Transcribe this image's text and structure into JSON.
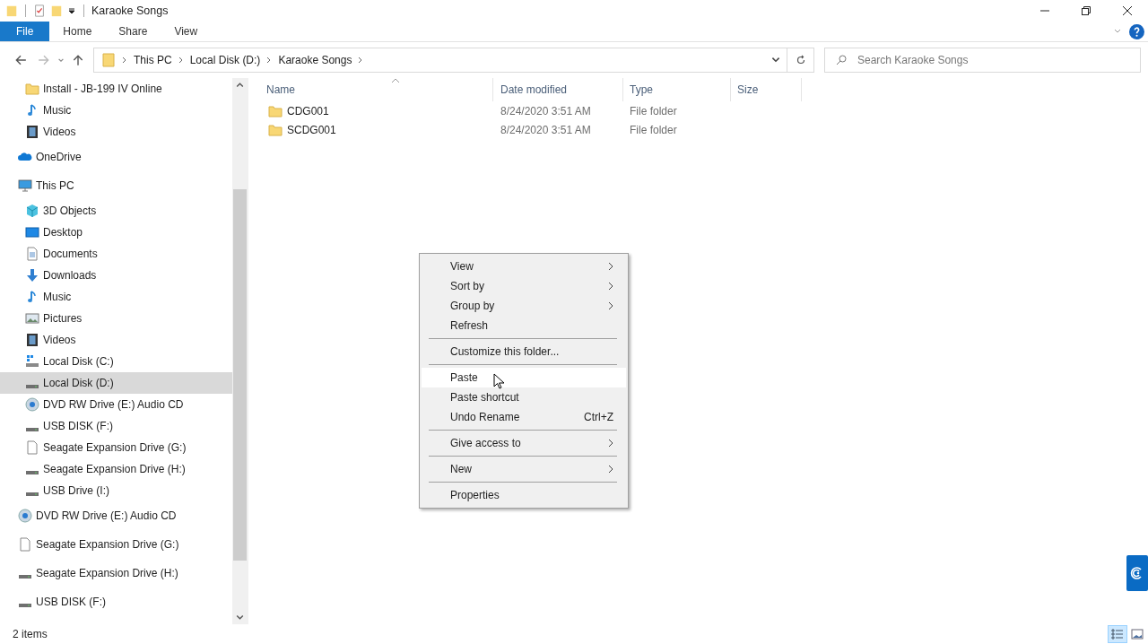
{
  "window": {
    "title": "Karaoke Songs"
  },
  "ribbon_tabs": [
    {
      "label": "File",
      "selected": true
    },
    {
      "label": "Home",
      "selected": false
    },
    {
      "label": "Share",
      "selected": false
    },
    {
      "label": "View",
      "selected": false
    }
  ],
  "breadcrumb": [
    "This PC",
    "Local Disk (D:)",
    "Karaoke Songs"
  ],
  "search": {
    "placeholder": "Search Karaoke Songs"
  },
  "navigation": {
    "pinned": [
      {
        "label": "Install - JB-199 IV Online",
        "kind": "folder",
        "selected": false
      },
      {
        "label": "Music",
        "kind": "music",
        "selected": false
      },
      {
        "label": "Videos",
        "kind": "videos",
        "selected": false
      }
    ],
    "items": [
      {
        "label": "OneDrive",
        "kind": "onedrive",
        "selected": false
      },
      {
        "label": "This PC",
        "kind": "pc",
        "selected": false,
        "children": [
          {
            "label": "3D Objects",
            "kind": "cube",
            "selected": false
          },
          {
            "label": "Desktop",
            "kind": "desktop",
            "selected": false
          },
          {
            "label": "Documents",
            "kind": "documents",
            "selected": false
          },
          {
            "label": "Downloads",
            "kind": "downloads",
            "selected": false
          },
          {
            "label": "Music",
            "kind": "music",
            "selected": false
          },
          {
            "label": "Pictures",
            "kind": "pictures",
            "selected": false
          },
          {
            "label": "Videos",
            "kind": "videos",
            "selected": false
          },
          {
            "label": "Local Disk (C:)",
            "kind": "windows",
            "selected": false
          },
          {
            "label": "Local Disk (D:)",
            "kind": "drive",
            "selected": true
          },
          {
            "label": "DVD RW Drive (E:) Audio CD",
            "kind": "disc",
            "selected": false
          },
          {
            "label": "USB DISK (F:)",
            "kind": "drive",
            "selected": false
          },
          {
            "label": "Seagate Expansion Drive (G:)",
            "kind": "blank",
            "selected": false
          },
          {
            "label": "Seagate Expansion Drive (H:)",
            "kind": "drive",
            "selected": false
          },
          {
            "label": "USB Drive (I:)",
            "kind": "drive",
            "selected": false
          }
        ]
      },
      {
        "label": "DVD RW Drive (E:) Audio CD",
        "kind": "disc",
        "selected": false
      },
      {
        "label": "Seagate Expansion Drive (G:)",
        "kind": "blank",
        "selected": false
      },
      {
        "label": "Seagate Expansion Drive (H:)",
        "kind": "drive",
        "selected": false
      },
      {
        "label": "USB DISK (F:)",
        "kind": "drive",
        "selected": false
      }
    ]
  },
  "file_list": {
    "columns": [
      "Name",
      "Date modified",
      "Type",
      "Size"
    ],
    "rows": [
      {
        "name": "CDG001",
        "date_modified": "8/24/2020 3:51 AM",
        "type": "File folder"
      },
      {
        "name": "SCDG001",
        "date_modified": "8/24/2020 3:51 AM",
        "type": "File folder"
      }
    ]
  },
  "context_menu": [
    {
      "kind": "item",
      "label": "View",
      "submenu": true,
      "hovered": false
    },
    {
      "kind": "item",
      "label": "Sort by",
      "submenu": true,
      "hovered": false
    },
    {
      "kind": "item",
      "label": "Group by",
      "submenu": true,
      "hovered": false
    },
    {
      "kind": "item",
      "label": "Refresh",
      "submenu": false,
      "hovered": false
    },
    {
      "kind": "separator"
    },
    {
      "kind": "item",
      "label": "Customize this folder...",
      "submenu": false,
      "hovered": false
    },
    {
      "kind": "separator"
    },
    {
      "kind": "item",
      "label": "Paste",
      "submenu": false,
      "hovered": true
    },
    {
      "kind": "item",
      "label": "Paste shortcut",
      "submenu": false,
      "hovered": false
    },
    {
      "kind": "item",
      "label": "Undo Rename",
      "shortcut": "Ctrl+Z",
      "submenu": false,
      "hovered": false
    },
    {
      "kind": "separator"
    },
    {
      "kind": "item",
      "label": "Give access to",
      "submenu": true,
      "hovered": false
    },
    {
      "kind": "separator"
    },
    {
      "kind": "item",
      "label": "New",
      "submenu": true,
      "hovered": false
    },
    {
      "kind": "separator"
    },
    {
      "kind": "item",
      "label": "Properties",
      "submenu": false,
      "hovered": false
    }
  ],
  "status_bar": {
    "item_count": "2 items"
  }
}
